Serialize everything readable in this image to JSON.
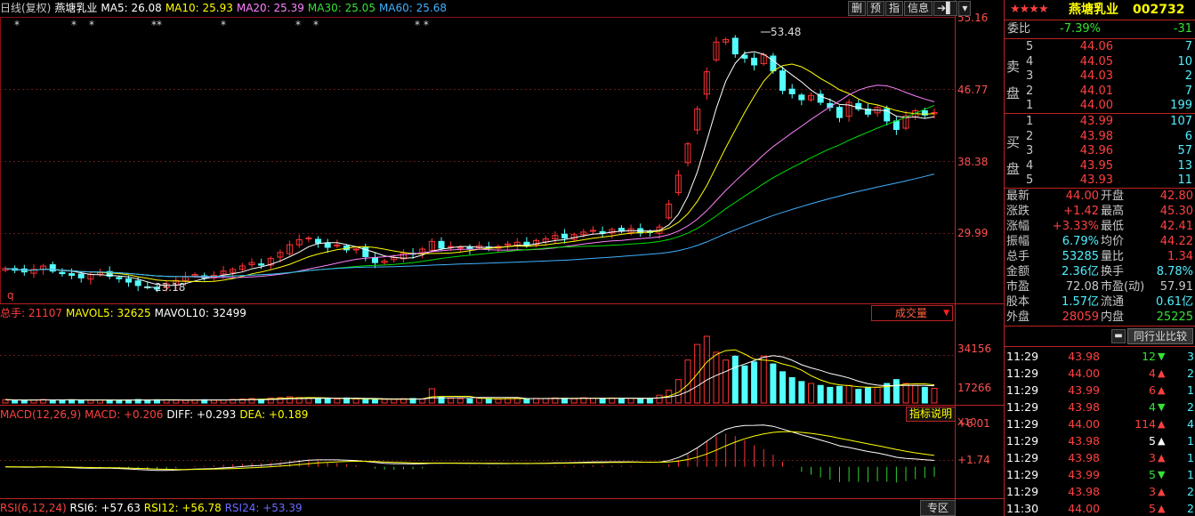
{
  "header": {
    "chart_type": "日线(复权)",
    "stock_name": "燕塘乳业",
    "ma5": "MA5: 26.08",
    "ma10": "MA10: 25.93",
    "ma20": "MA20: 25.39",
    "ma30": "MA30: 25.05",
    "ma60": "MA60: 25.68",
    "buttons": [
      "删",
      "预",
      "指",
      "信息",
      "➔▌",
      "▾"
    ]
  },
  "price_axis": [
    "55.16",
    "46.77",
    "38.38",
    "29.99"
  ],
  "annotations": {
    "high": "53.48",
    "low": "23.18",
    "q": "q"
  },
  "volume_header": {
    "total": "总手: 21107",
    "mavol5": "MAVOL5: 32625",
    "mavol10": "MAVOL10: 32499",
    "dropdown": "成交量"
  },
  "volume_axis": [
    "34156",
    "17266",
    "X10"
  ],
  "macd_header": {
    "name": "MACD(12,26,9)",
    "macd": "MACD: +0.206",
    "diff": "DIFF: +0.293",
    "dea": "DEA: +0.189",
    "help": "指标说明"
  },
  "macd_axis": [
    "+6.01",
    "+1.74"
  ],
  "rsi_header": {
    "name": "RSI(6,12,24)",
    "rsi6": "RSI6: +57.63",
    "rsi12": "RSI12: +56.78",
    "rsi24": "RSI24: +53.39",
    "button": "专区"
  },
  "colors": {
    "up": "#ff3232",
    "down": "#54ffff",
    "ma5": "#ffffff",
    "ma10": "#ffff00",
    "ma20": "#ff80ff",
    "ma30": "#00e000",
    "ma60": "#40b0ff",
    "border": "#b22222"
  },
  "quote": {
    "stars": "★★★★",
    "name": "燕塘乳业",
    "code": "002732",
    "weibi_label": "委比",
    "weibi": "-7.39%",
    "weicha": "-31",
    "sell_label": [
      "卖",
      "盘"
    ],
    "buy_label": [
      "买",
      "盘"
    ],
    "sell": [
      {
        "lvl": "5",
        "price": "44.06",
        "vol": "7"
      },
      {
        "lvl": "4",
        "price": "44.05",
        "vol": "10"
      },
      {
        "lvl": "3",
        "price": "44.03",
        "vol": "2"
      },
      {
        "lvl": "2",
        "price": "44.01",
        "vol": "7"
      },
      {
        "lvl": "1",
        "price": "44.00",
        "vol": "199"
      }
    ],
    "buy": [
      {
        "lvl": "1",
        "price": "43.99",
        "vol": "107"
      },
      {
        "lvl": "2",
        "price": "43.98",
        "vol": "6"
      },
      {
        "lvl": "3",
        "price": "43.96",
        "vol": "57"
      },
      {
        "lvl": "4",
        "price": "43.95",
        "vol": "13"
      },
      {
        "lvl": "5",
        "price": "43.93",
        "vol": "11"
      }
    ],
    "stats": [
      {
        "l1": "最新",
        "v1": "44.00",
        "c1": "red",
        "l2": "开盘",
        "v2": "42.80",
        "c2": "red"
      },
      {
        "l1": "涨跌",
        "v1": "+1.42",
        "c1": "red",
        "l2": "最高",
        "v2": "45.30",
        "c2": "red"
      },
      {
        "l1": "涨幅",
        "v1": "+3.33%",
        "c1": "red",
        "l2": "最低",
        "v2": "42.41",
        "c2": "red"
      },
      {
        "l1": "振幅",
        "v1": "6.79%",
        "c1": "cyan",
        "l2": "均价",
        "v2": "44.22",
        "c2": "red"
      },
      {
        "l1": "总手",
        "v1": "53285",
        "c1": "cyan",
        "l2": "量比",
        "v2": "1.34",
        "c2": "red"
      },
      {
        "l1": "金额",
        "v1": "2.36亿",
        "c1": "cyan",
        "l2": "换手",
        "v2": "8.78%",
        "c2": "cyan"
      },
      {
        "l1": "市盈",
        "v1": "72.08",
        "c1": "gry",
        "l2": "市盈(动)",
        "v2": "57.91",
        "c2": "gry"
      },
      {
        "l1": "股本",
        "v1": "1.57亿",
        "c1": "cyan",
        "l2": "流通",
        "v2": "0.61亿",
        "c2": "cyan"
      },
      {
        "l1": "外盘",
        "v1": "28059",
        "c1": "red",
        "l2": "内盘",
        "v2": "25225",
        "c2": "grn"
      }
    ],
    "compare_button": "同行业比较",
    "ticks": [
      {
        "t": "11:29",
        "p": "43.98",
        "pc": "red",
        "v": "12",
        "dir": "down",
        "n": "3"
      },
      {
        "t": "11:29",
        "p": "44.00",
        "pc": "red",
        "v": "4",
        "dir": "up",
        "n": "2"
      },
      {
        "t": "11:29",
        "p": "43.99",
        "pc": "red",
        "v": "6",
        "dir": "up",
        "n": "1"
      },
      {
        "t": "11:29",
        "p": "43.98",
        "pc": "red",
        "v": "4",
        "dir": "down",
        "n": "2"
      },
      {
        "t": "11:29",
        "p": "44.00",
        "pc": "red",
        "v": "114",
        "dir": "up",
        "n": "4"
      },
      {
        "t": "11:29",
        "p": "43.98",
        "pc": "red",
        "v": "5",
        "dir": "neutral",
        "n": "1"
      },
      {
        "t": "11:29",
        "p": "43.98",
        "pc": "red",
        "v": "3",
        "dir": "up",
        "n": "1"
      },
      {
        "t": "11:29",
        "p": "43.99",
        "pc": "red",
        "v": "5",
        "dir": "down",
        "n": "1"
      },
      {
        "t": "11:29",
        "p": "43.98",
        "pc": "red",
        "v": "3",
        "dir": "up",
        "n": "2"
      },
      {
        "t": "11:30",
        "p": "44.00",
        "pc": "red",
        "v": "5",
        "dir": "up",
        "n": "2"
      }
    ]
  },
  "chart_data": {
    "type": "candlestick",
    "price_range": [
      21.6,
      55.16
    ],
    "high": 53.48,
    "low": 23.18,
    "close_series": [
      25.6,
      25.4,
      25.2,
      25.5,
      25.9,
      25.3,
      25.0,
      24.8,
      24.5,
      24.9,
      25.1,
      24.7,
      24.4,
      24.0,
      23.6,
      23.4,
      23.18,
      23.8,
      24.2,
      24.6,
      24.9,
      24.5,
      24.8,
      25.3,
      25.5,
      25.9,
      26.3,
      26.0,
      26.8,
      27.5,
      28.4,
      29.0,
      29.2,
      28.6,
      28.1,
      28.4,
      27.8,
      27.9,
      27.0,
      26.3,
      26.5,
      26.9,
      27.4,
      27.3,
      27.9,
      28.8,
      28.0,
      28.2,
      28.1,
      27.9,
      28.3,
      28.0,
      28.2,
      28.5,
      28.7,
      28.3,
      28.9,
      29.1,
      29.5,
      29.2,
      29.6,
      29.9,
      30.1,
      29.8,
      30.2,
      30.0,
      30.3,
      29.8,
      29.9,
      30.5,
      33.2,
      36.6,
      40.3,
      44.4,
      48.8,
      52.3,
      52.6,
      50.9,
      50.4,
      49.6,
      50.8,
      48.9,
      46.6,
      46.2,
      45.5,
      46.0,
      45.2,
      44.6,
      43.4,
      45.2,
      44.4,
      43.8,
      44.6,
      43.0,
      42.0,
      43.6,
      44.2,
      43.7,
      44.0
    ],
    "volume_x10": [
      1700,
      1500,
      1400,
      1600,
      1800,
      1500,
      1600,
      1700,
      1400,
      1500,
      1600,
      1500,
      1400,
      1600,
      1800,
      1500,
      1700,
      1600,
      1500,
      1400,
      1600,
      1700,
      1500,
      1600,
      1800,
      2000,
      2300,
      1900,
      2500,
      2800,
      3200,
      2800,
      2500,
      2300,
      2200,
      2000,
      2600,
      2100,
      1800,
      1700,
      1900,
      2000,
      2200,
      2300,
      2100,
      7300,
      3000,
      2400,
      2200,
      2100,
      2500,
      2200,
      2000,
      2300,
      2500,
      2200,
      2400,
      2300,
      2600,
      2400,
      2200,
      2700,
      2500,
      2400,
      2600,
      2300,
      2500,
      2200,
      2400,
      4000,
      6500,
      12000,
      22000,
      30000,
      34156,
      26000,
      22000,
      24000,
      19000,
      21000,
      24000,
      20000,
      16000,
      13000,
      11000,
      10000,
      9000,
      8000,
      8500,
      9000,
      7000,
      8000,
      8000,
      10000,
      12000,
      10000,
      9000,
      8000,
      7500
    ],
    "macd_range": [
      -4.0,
      7.0
    ],
    "axis_labels": [
      "55.16",
      "46.77",
      "38.38",
      "29.99"
    ]
  }
}
